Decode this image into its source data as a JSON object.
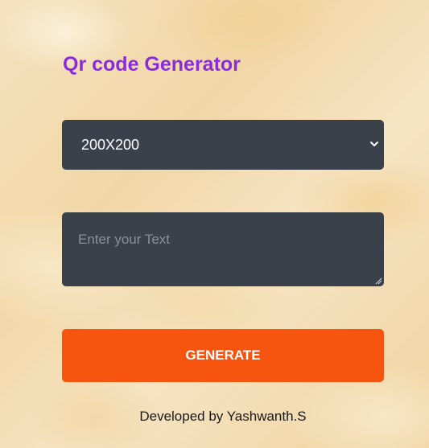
{
  "app": {
    "title": "Qr code Generator"
  },
  "size_select": {
    "selected": "200X200",
    "icon": "chevron-down-icon"
  },
  "text_input": {
    "placeholder": "Enter your Text",
    "value": ""
  },
  "generate_button": {
    "label": "GENERATE"
  },
  "footer": {
    "credit": "Developed by Yashwanth.S"
  },
  "colors": {
    "title": "#8a2be2",
    "field_bg": "#3b414b",
    "button_bg": "#f6540f",
    "background": "#f3dcb1"
  }
}
